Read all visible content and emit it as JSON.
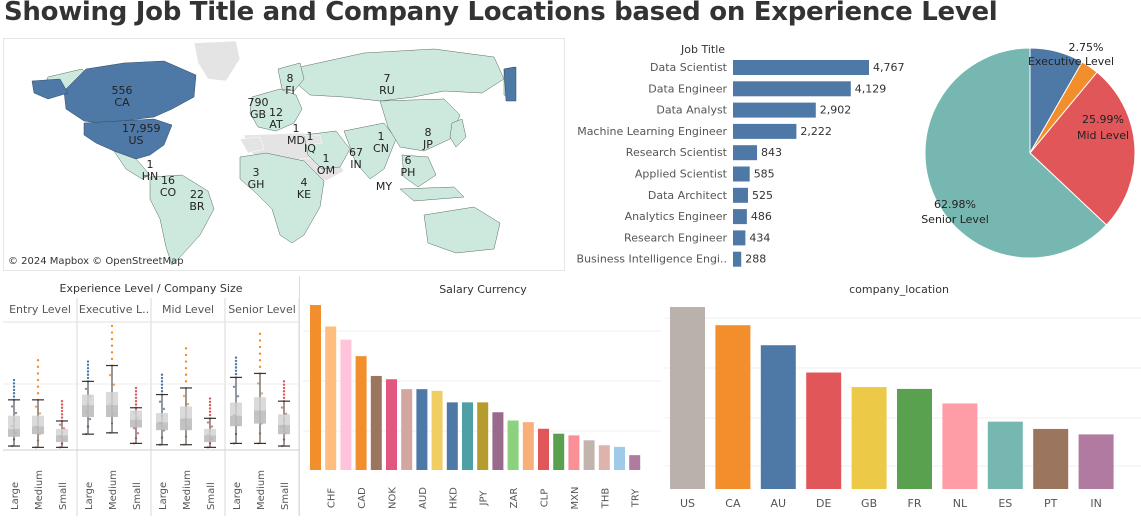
{
  "title": "Showing Job Title and Company Locations based on Experience Level",
  "map": {
    "attribution": "© 2024 Mapbox © OpenStreetMap",
    "labels": [
      {
        "code": "CA",
        "value": "556"
      },
      {
        "code": "US",
        "value": "17,959"
      },
      {
        "code": "RU",
        "value": "7"
      },
      {
        "code": "GB",
        "value": "790"
      },
      {
        "code": "FI",
        "value": "8"
      },
      {
        "code": "AT",
        "value": "12"
      },
      {
        "code": "MD",
        "value": "1"
      },
      {
        "code": "HN",
        "value": "1"
      },
      {
        "code": "CO",
        "value": "16"
      },
      {
        "code": "BR",
        "value": "22"
      },
      {
        "code": "GH",
        "value": "3"
      },
      {
        "code": "KE",
        "value": "4"
      },
      {
        "code": "IQ",
        "value": "1"
      },
      {
        "code": "OM",
        "value": "1"
      },
      {
        "code": "IN",
        "value": "67"
      },
      {
        "code": "CN",
        "value": "1"
      },
      {
        "code": "JP",
        "value": "8"
      },
      {
        "code": "PH",
        "value": "6"
      },
      {
        "code": "MY",
        "value": ""
      }
    ]
  },
  "colors": {
    "bar_blue": "#4e79a7",
    "pie_blue": "#4e79a7",
    "pie_orange": "#f28e2b",
    "pie_red": "#e15759",
    "pie_teal": "#76b7b2",
    "map_fill": "#cde8dc",
    "map_dark": "#4e79a7"
  },
  "chart_data": [
    {
      "type": "bar",
      "orientation": "horizontal",
      "title": "Job Title",
      "categories": [
        "Data Scientist",
        "Data Engineer",
        "Data Analyst",
        "Machine Learning Engineer",
        "Research Scientist",
        "Applied Scientist",
        "Data Architect",
        "Analytics Engineer",
        "Research Engineer",
        "Business Intelligence Engi.."
      ],
      "values": [
        4767,
        4129,
        2902,
        2222,
        843,
        585,
        525,
        486,
        434,
        288
      ],
      "value_labels": [
        "4,767",
        "4,129",
        "2,902",
        "2,222",
        "843",
        "585",
        "525",
        "486",
        "434",
        "288"
      ]
    },
    {
      "type": "pie",
      "title": "",
      "slices": [
        {
          "name": "Entry Level",
          "pct": "8.28%",
          "value": 8.28,
          "color": "#4e79a7"
        },
        {
          "name": "Executive Level",
          "pct": "2.75%",
          "value": 2.75,
          "color": "#f28e2b"
        },
        {
          "name": "Mid Level",
          "pct": "25.99%",
          "value": 25.99,
          "color": "#e15759"
        },
        {
          "name": "Senior Level",
          "pct": "62.98%",
          "value": 62.98,
          "color": "#76b7b2"
        }
      ],
      "visible_labels": [
        {
          "pct": "2.75%",
          "name": "Executive Level"
        },
        {
          "pct": "25.99%",
          "name": "Mid Level"
        },
        {
          "pct": "62.98%",
          "name": "Senior Level"
        }
      ]
    },
    {
      "type": "boxplot",
      "title": "Experience Level  /  Company Size",
      "panels": [
        "Entry Level",
        "Executive L..",
        "Mid Level",
        "Senior Level"
      ],
      "categories": [
        "Large",
        "Medium",
        "Small"
      ],
      "boxes": [
        [
          {
            "q1": 0.1,
            "med": 0.16,
            "q3": 0.26,
            "lo": 0.03,
            "hi": 0.38,
            "color": "#4e79a7"
          },
          {
            "q1": 0.12,
            "med": 0.18,
            "q3": 0.26,
            "lo": 0.02,
            "hi": 0.38,
            "color": "#f28e2b"
          },
          {
            "q1": 0.06,
            "med": 0.11,
            "q3": 0.16,
            "lo": 0.02,
            "hi": 0.22,
            "color": "#e15759"
          }
        ],
        [
          {
            "q1": 0.25,
            "med": 0.34,
            "q3": 0.42,
            "lo": 0.12,
            "hi": 0.52,
            "color": "#4e79a7"
          },
          {
            "q1": 0.25,
            "med": 0.34,
            "q3": 0.44,
            "lo": 0.13,
            "hi": 0.64,
            "color": "#f28e2b"
          },
          {
            "q1": 0.17,
            "med": 0.23,
            "q3": 0.3,
            "lo": 0.05,
            "hi": 0.32,
            "color": "#e15759"
          }
        ],
        [
          {
            "q1": 0.15,
            "med": 0.21,
            "q3": 0.28,
            "lo": 0.04,
            "hi": 0.42,
            "color": "#4e79a7"
          },
          {
            "q1": 0.15,
            "med": 0.24,
            "q3": 0.33,
            "lo": 0.04,
            "hi": 0.47,
            "color": "#f28e2b"
          },
          {
            "q1": 0.06,
            "med": 0.11,
            "q3": 0.16,
            "lo": 0.02,
            "hi": 0.24,
            "color": "#e15759"
          }
        ],
        [
          {
            "q1": 0.18,
            "med": 0.26,
            "q3": 0.36,
            "lo": 0.05,
            "hi": 0.55,
            "color": "#4e79a7"
          },
          {
            "q1": 0.2,
            "med": 0.3,
            "q3": 0.4,
            "lo": 0.05,
            "hi": 0.58,
            "color": "#f28e2b"
          },
          {
            "q1": 0.12,
            "med": 0.19,
            "q3": 0.27,
            "lo": 0.03,
            "hi": 0.37,
            "color": "#e15759"
          }
        ]
      ]
    },
    {
      "type": "bar",
      "title": "Salary Currency",
      "tick_labels": [
        "CHF",
        "CAD",
        "NOK",
        "AUD",
        "HKD",
        "JPY",
        "ZAR",
        "CLP",
        "MXN",
        "THB",
        "TRY"
      ],
      "values": [
        1.0,
        0.87,
        0.79,
        0.69,
        0.57,
        0.55,
        0.49,
        0.49,
        0.48,
        0.41,
        0.41,
        0.41,
        0.35,
        0.3,
        0.29,
        0.25,
        0.22,
        0.21,
        0.18,
        0.15,
        0.14,
        0.09
      ],
      "colors": [
        "#f28e2b",
        "#ffbe7d",
        "#ffc4d9",
        "#f28e2b",
        "#9c755f",
        "#e15780",
        "#d4a6a0",
        "#4e79a7",
        "#f1ce63",
        "#4e79a7",
        "#4e9fa6",
        "#b69b2f",
        "#9a6a8c",
        "#8cd17d",
        "#f7b07a",
        "#e15759",
        "#59a14f",
        "#fb8f98",
        "#c3b3ad",
        "#ddb3ac",
        "#a0cbe8",
        "#b07aa1"
      ]
    },
    {
      "type": "bar",
      "title": "company_location",
      "categories": [
        "US",
        "CA",
        "AU",
        "DE",
        "GB",
        "FR",
        "NL",
        "ES",
        "PT",
        "IN"
      ],
      "values": [
        1.0,
        0.9,
        0.79,
        0.64,
        0.56,
        0.55,
        0.47,
        0.37,
        0.33,
        0.3
      ],
      "colors": [
        "#bab0ac",
        "#f28e2b",
        "#4e79a7",
        "#e15759",
        "#edc948",
        "#59a14f",
        "#ff9da7",
        "#76b7b2",
        "#9c755f",
        "#b07aa1"
      ]
    }
  ]
}
